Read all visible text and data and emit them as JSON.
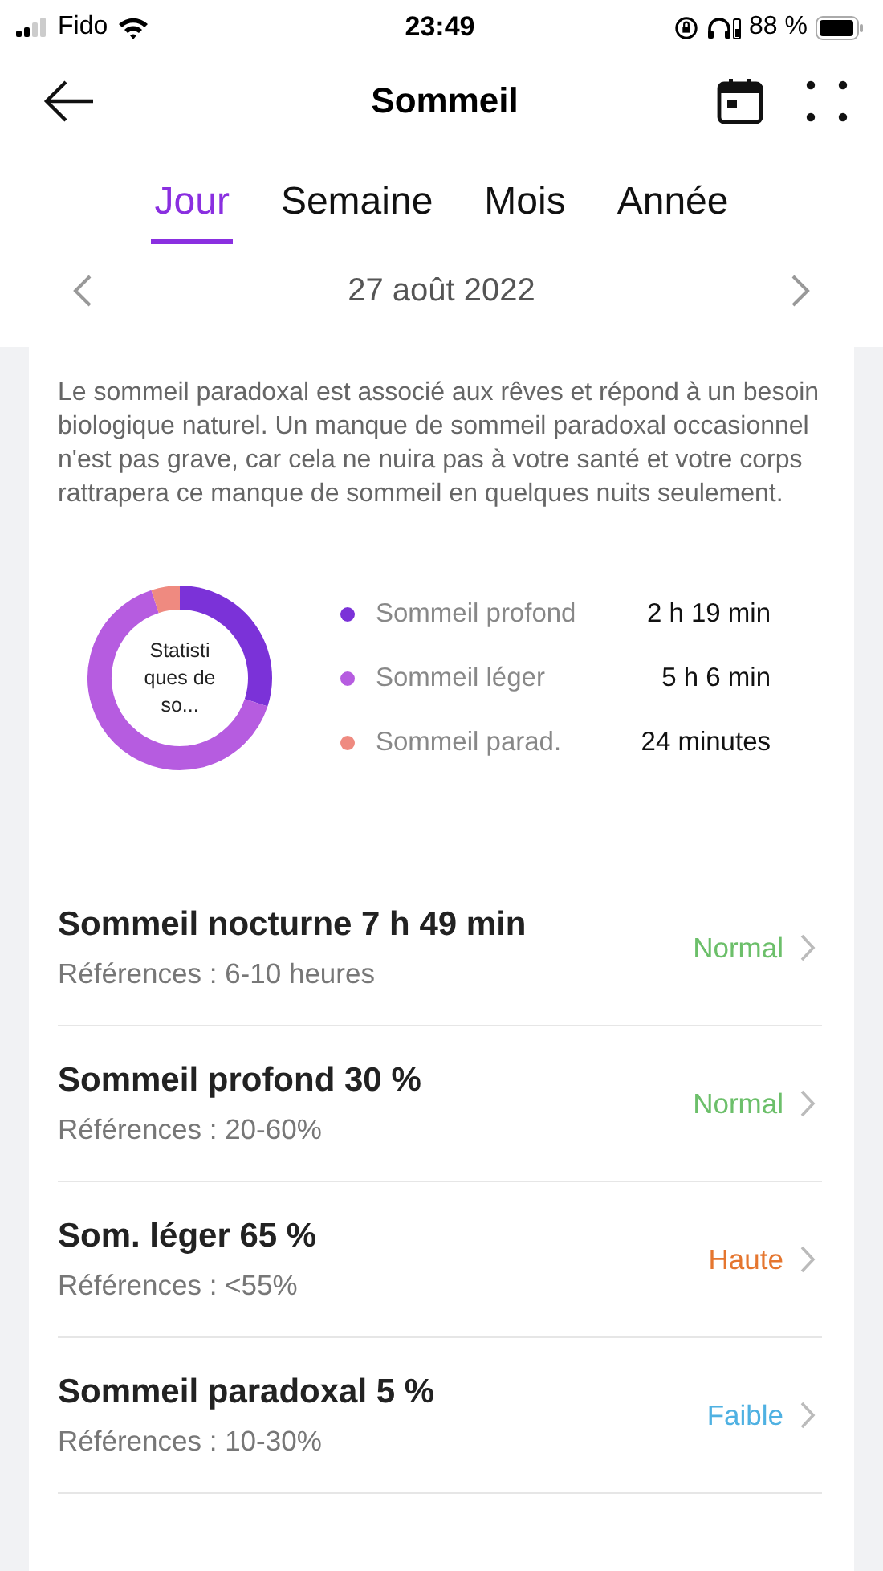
{
  "status_bar": {
    "carrier": "Fido",
    "time": "23:49",
    "battery": "88 %"
  },
  "header": {
    "title": "Sommeil"
  },
  "tabs": [
    {
      "label": "Jour",
      "selected": true
    },
    {
      "label": "Semaine",
      "selected": false
    },
    {
      "label": "Mois",
      "selected": false
    },
    {
      "label": "Année",
      "selected": false
    }
  ],
  "date": "27 août 2022",
  "description": "Le sommeil paradoxal est associé aux rêves et répond à un besoin biologique naturel. Un manque de sommeil paradoxal occasionnel n'est pas grave, car cela ne nuira pas à votre santé et votre corps rattrapera ce manque de sommeil en quelques nuits seulement.",
  "donut": {
    "center": "Statisti ques de so..."
  },
  "legend": [
    {
      "label": "Sommeil profond",
      "value": "2 h 19 min",
      "color": "#7b32d8"
    },
    {
      "label": "Sommeil léger",
      "value": "5 h 6 min",
      "color": "#b65ce0"
    },
    {
      "label": "Sommeil parad.",
      "value": "24 minutes",
      "color": "#ef8a80"
    }
  ],
  "metrics": [
    {
      "title": "Sommeil nocturne 7 h 49 min",
      "reference": "Références : 6-10 heures",
      "status": "Normal",
      "color": "#6cbf6a"
    },
    {
      "title": "Sommeil profond 30 %",
      "reference": "Références : 20-60%",
      "status": "Normal",
      "color": "#6cbf6a"
    },
    {
      "title": "Som. léger 65 %",
      "reference": "Références : <55%",
      "status": "Haute",
      "color": "#e5762f"
    },
    {
      "title": "Sommeil paradoxal 5 %",
      "reference": "Références : 10-30%",
      "status": "Faible",
      "color": "#4fb1e2"
    }
  ]
}
